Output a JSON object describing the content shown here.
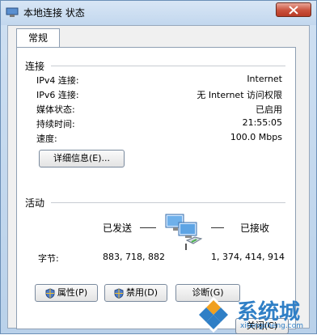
{
  "window": {
    "title": "本地连接 状态"
  },
  "tabs": [
    {
      "label": "常规"
    }
  ],
  "connection": {
    "heading": "连接",
    "rows": [
      {
        "label": "IPv4 连接:",
        "value": "Internet"
      },
      {
        "label": "IPv6 连接:",
        "value": "无 Internet 访问权限"
      },
      {
        "label": "媒体状态:",
        "value": "已启用"
      },
      {
        "label": "持续时间:",
        "value": "21:55:05"
      },
      {
        "label": "速度:",
        "value": "100.0 Mbps"
      }
    ],
    "details_button": "详细信息(E)..."
  },
  "activity": {
    "heading": "活动",
    "sent_label": "已发送",
    "received_label": "已接收",
    "bytes_label": "字节:",
    "bytes_sent": "883, 718, 882",
    "bytes_received": "1, 374, 414, 914"
  },
  "buttons": {
    "properties": "属性(P)",
    "disable": "禁用(D)",
    "diagnose": "诊断(G)",
    "close": "关闭(C)"
  },
  "watermark": {
    "big": "系统城",
    "small": "xitongcheng.com"
  },
  "colors": {
    "accent": "#2f7fc6",
    "close_red": "#c9513c"
  }
}
